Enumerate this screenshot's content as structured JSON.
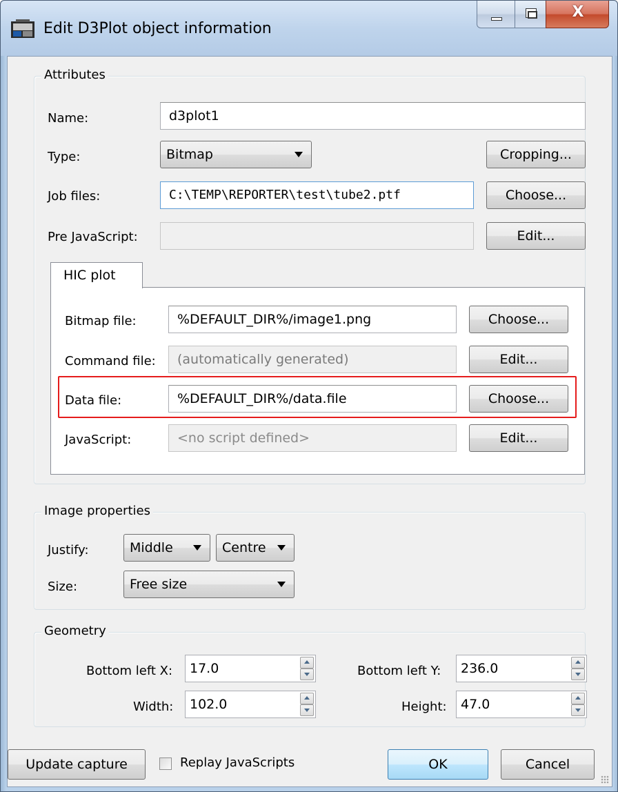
{
  "window": {
    "title": "Edit D3Plot object information",
    "close_glyph": "X"
  },
  "attributes": {
    "legend": "Attributes",
    "name_label": "Name:",
    "name_value": "d3plot1",
    "type_label": "Type:",
    "type_value": "Bitmap",
    "cropping_button": "Cropping...",
    "jobfiles_label": "Job files:",
    "jobfiles_value": "C:\\TEMP\\REPORTER\\test\\tube2.ptf",
    "jobfiles_choose": "Choose...",
    "prejs_label": "Pre JavaScript:",
    "prejs_value": "",
    "prejs_edit": "Edit..."
  },
  "hic_tab": {
    "tab_label": "HIC plot",
    "bitmap_label": "Bitmap file:",
    "bitmap_value": "%DEFAULT_DIR%/image1.png",
    "bitmap_choose": "Choose...",
    "command_label": "Command file:",
    "command_value": "(automatically generated)",
    "command_edit": "Edit...",
    "data_label": "Data file:",
    "data_value": "%DEFAULT_DIR%/data.file",
    "data_choose": "Choose...",
    "js_label": "JavaScript:",
    "js_value": "<no script defined>",
    "js_edit": "Edit..."
  },
  "image_props": {
    "legend": "Image properties",
    "justify_label": "Justify:",
    "justify_v": "Middle",
    "justify_h": "Centre",
    "size_label": "Size:",
    "size_value": "Free size"
  },
  "geometry": {
    "legend": "Geometry",
    "blx_label": "Bottom left X:",
    "blx_value": "17.0",
    "bly_label": "Bottom left Y:",
    "bly_value": "236.0",
    "width_label": "Width:",
    "width_value": "102.0",
    "height_label": "Height:",
    "height_value": "47.0"
  },
  "footer": {
    "update_capture": "Update capture",
    "replay_label": "Replay JavaScripts",
    "replay_checked": false,
    "ok": "OK",
    "cancel": "Cancel"
  },
  "colors": {
    "highlight": "#e51b1b",
    "title_bar": "#bfd4ec",
    "dialog_bg": "#f0f0f0"
  }
}
